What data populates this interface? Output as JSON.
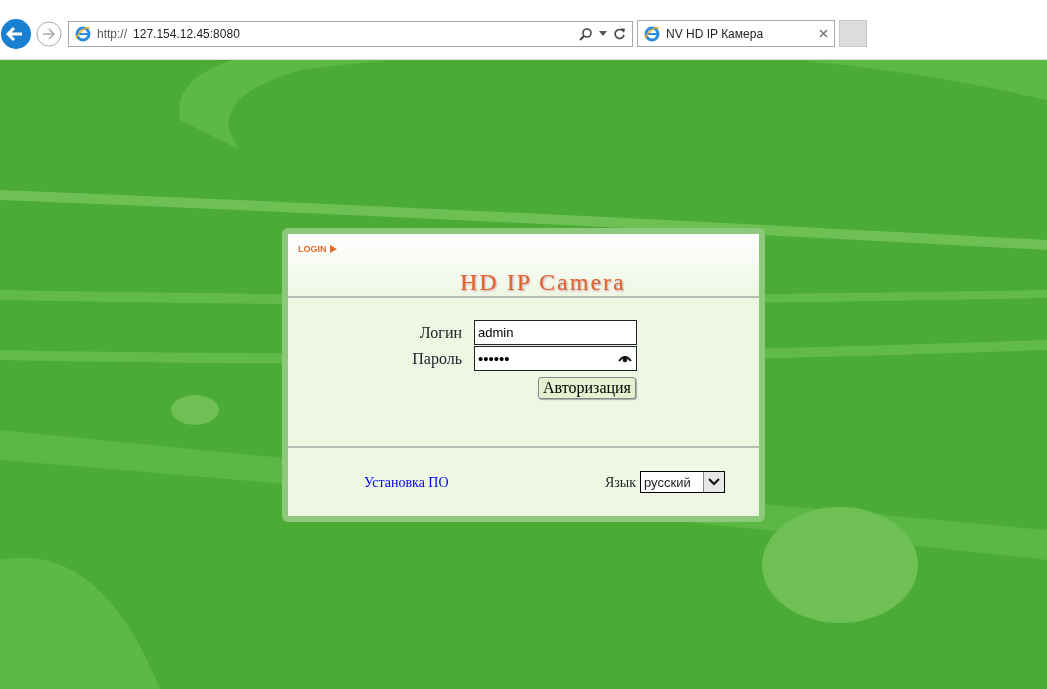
{
  "browser": {
    "address": {
      "scheme": "http://",
      "host": "127.154.12.45:8080"
    },
    "tabs": [
      {
        "title": "NV HD IP Камера",
        "selected": true
      }
    ]
  },
  "login": {
    "tag": "LOGIN",
    "title": "HD IP Camera",
    "fields": [
      {
        "label": "Логин",
        "value": "admin",
        "kind": "text"
      },
      {
        "label": "Пароль",
        "value": "••••••",
        "kind": "password"
      }
    ],
    "submit": "Авторизация",
    "install_link": "Установка ПО",
    "language": {
      "label": "Язык",
      "value": "русский"
    }
  }
}
